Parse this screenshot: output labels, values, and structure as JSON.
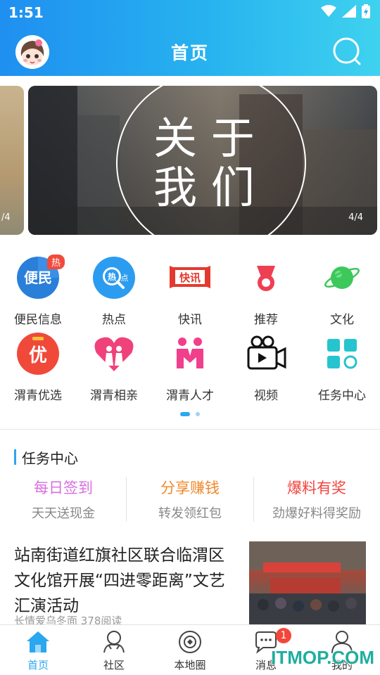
{
  "status_bar": {
    "time": "1:51"
  },
  "header": {
    "title": "首页"
  },
  "banner": {
    "counter_prev": "/4",
    "counter_main": "4/4",
    "text_line1": "关 于",
    "text_line2": "我 们"
  },
  "grid": {
    "hot_badge": "热",
    "items": [
      {
        "label": "便民信息",
        "icon": "bianmin-icon",
        "icon_text": "便民"
      },
      {
        "label": "热点",
        "icon": "hotspot-icon",
        "icon_text": "热点"
      },
      {
        "label": "快讯",
        "icon": "news-flash-icon",
        "icon_text": "快讯"
      },
      {
        "label": "推荐",
        "icon": "recommend-medal-icon"
      },
      {
        "label": "文化",
        "icon": "culture-planet-icon"
      },
      {
        "label": "渭青优选",
        "icon": "youxuan-icon",
        "icon_text": "优"
      },
      {
        "label": "渭青相亲",
        "icon": "dating-heart-icon"
      },
      {
        "label": "渭青人才",
        "icon": "talent-icon"
      },
      {
        "label": "视频",
        "icon": "video-camera-icon"
      },
      {
        "label": "任务中心",
        "icon": "task-center-icon"
      }
    ]
  },
  "pager": {
    "page": 1,
    "total": 2
  },
  "task_center": {
    "title": "任务中心",
    "tasks": [
      {
        "title": "每日签到",
        "subtitle": "天天送现金",
        "color": "#d86fe0"
      },
      {
        "title": "分享赚钱",
        "subtitle": "转发领红包",
        "color": "#f0892b"
      },
      {
        "title": "爆料有奖",
        "subtitle": "劲爆好料得奖励",
        "color": "#f1443d"
      }
    ]
  },
  "news": {
    "title": "站南街道红旗社区联合临渭区文化馆开展“四进零距离”文艺汇演活动",
    "meta": "长情爱乌冬面    378阅读"
  },
  "tabbar": {
    "items": [
      {
        "label": "首页",
        "icon": "home-icon",
        "active": true
      },
      {
        "label": "社区",
        "icon": "community-icon"
      },
      {
        "label": "本地圈",
        "icon": "local-circle-icon"
      },
      {
        "label": "消息",
        "icon": "message-icon",
        "badge": "1"
      },
      {
        "label": "我的",
        "icon": "profile-icon"
      }
    ]
  },
  "watermark": "ITMOP.COM",
  "colors": {
    "accent": "#2aa7ef",
    "header_start": "#1f8ff0",
    "header_end": "#3fd2ef",
    "badge_red": "#f4463a"
  }
}
